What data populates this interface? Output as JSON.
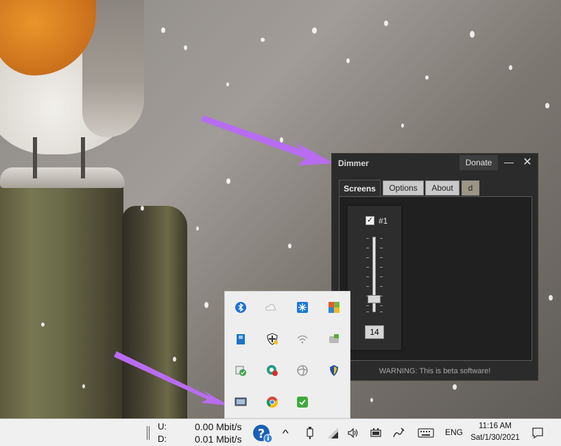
{
  "dimmer": {
    "title": "Dimmer",
    "donate_label": "Donate",
    "minimize_symbol": "—",
    "close_symbol": "✕",
    "tabs": [
      "Screens",
      "Options",
      "About",
      "d"
    ],
    "screen": {
      "checked": true,
      "check_symbol": "✓",
      "label": "#1",
      "slider_value": 14
    },
    "warning": "WARNING: This is beta software!"
  },
  "tray_flyout": {
    "icons": [
      "bluetooth-icon",
      "cloud-icon",
      "snowflake-icon",
      "office-icon",
      "usb-drive-icon",
      "security-shield-icon",
      "wifi-icon",
      "device-icon",
      "sync-icon",
      "chrome-remote-icon",
      "pinwheel-icon",
      "usb-stick-icon",
      "display-icon",
      "chrome-icon",
      "checkmark-icon"
    ]
  },
  "taskbar": {
    "upload_label": "U:",
    "download_label": "D:",
    "upload_speed": "0.00 Mbit/s",
    "download_speed": "0.01 Mbit/s",
    "chevron": "^",
    "language": "ENG",
    "time": "11:16 AM",
    "date": "Sat/1/30/2021"
  },
  "colors": {
    "dimmer_bg": "#2b2b2b",
    "tab_panel_bg": "#202020",
    "arrow": "#b86cf2",
    "taskbar_bg": "#f0f0f0"
  }
}
